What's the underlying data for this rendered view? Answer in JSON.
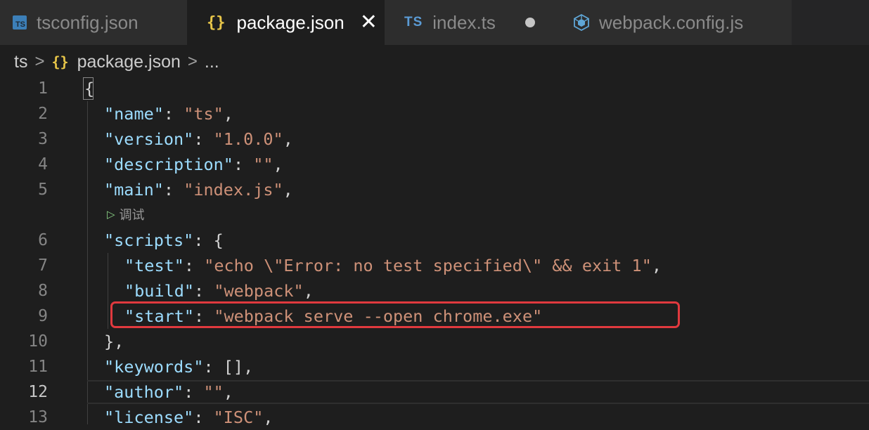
{
  "tabs": [
    {
      "label": "tsconfig.json",
      "icon": "ts-file-icon",
      "active": false
    },
    {
      "label": "package.json",
      "icon": "json-braces-icon",
      "active": true
    },
    {
      "label": "index.ts",
      "icon": "ts-text-icon",
      "active": false,
      "dirty": true
    },
    {
      "label": "webpack.config.js",
      "icon": "webpack-cube-icon",
      "active": false
    }
  ],
  "icon_text": {
    "ts": "TS",
    "braces": "{}",
    "close": "✕"
  },
  "breadcrumb": {
    "root": "ts",
    "file": "package.json",
    "tail": "...",
    "sep": ">"
  },
  "codelens": {
    "label": "调试",
    "icon": "play-icon"
  },
  "current_line": 12,
  "colors": {
    "key": "#9cdcfe",
    "string": "#ce9178",
    "highlight": "#e0393e",
    "accent_braces": "#e8c649"
  },
  "lines": [
    {
      "n": "1",
      "indent": 0,
      "tokens": [
        {
          "t": "{",
          "c": "p"
        }
      ]
    },
    {
      "n": "2",
      "indent": 1,
      "tokens": [
        {
          "t": "\"name\"",
          "c": "k"
        },
        {
          "t": ": ",
          "c": "p"
        },
        {
          "t": "\"ts\"",
          "c": "s"
        },
        {
          "t": ",",
          "c": "p"
        }
      ]
    },
    {
      "n": "3",
      "indent": 1,
      "tokens": [
        {
          "t": "\"version\"",
          "c": "k"
        },
        {
          "t": ": ",
          "c": "p"
        },
        {
          "t": "\"1.0.0\"",
          "c": "s"
        },
        {
          "t": ",",
          "c": "p"
        }
      ]
    },
    {
      "n": "4",
      "indent": 1,
      "tokens": [
        {
          "t": "\"description\"",
          "c": "k"
        },
        {
          "t": ": ",
          "c": "p"
        },
        {
          "t": "\"\"",
          "c": "s"
        },
        {
          "t": ",",
          "c": "p"
        }
      ]
    },
    {
      "n": "5",
      "indent": 1,
      "tokens": [
        {
          "t": "\"main\"",
          "c": "k"
        },
        {
          "t": ": ",
          "c": "p"
        },
        {
          "t": "\"index.js\"",
          "c": "s"
        },
        {
          "t": ",",
          "c": "p"
        }
      ]
    },
    {
      "n": "6",
      "indent": 1,
      "tokens": [
        {
          "t": "\"scripts\"",
          "c": "k"
        },
        {
          "t": ": {",
          "c": "p"
        }
      ]
    },
    {
      "n": "7",
      "indent": 2,
      "tokens": [
        {
          "t": "\"test\"",
          "c": "k"
        },
        {
          "t": ": ",
          "c": "p"
        },
        {
          "t": "\"echo \\\"Error: no test specified\\\" && exit 1\"",
          "c": "s"
        },
        {
          "t": ",",
          "c": "p"
        }
      ]
    },
    {
      "n": "8",
      "indent": 2,
      "tokens": [
        {
          "t": "\"build\"",
          "c": "k"
        },
        {
          "t": ": ",
          "c": "p"
        },
        {
          "t": "\"webpack\"",
          "c": "s"
        },
        {
          "t": ",",
          "c": "p"
        }
      ]
    },
    {
      "n": "9",
      "indent": 2,
      "tokens": [
        {
          "t": "\"start\"",
          "c": "k"
        },
        {
          "t": ": ",
          "c": "p"
        },
        {
          "t": "\"webpack serve --open chrome.exe\"",
          "c": "s"
        }
      ]
    },
    {
      "n": "10",
      "indent": 1,
      "tokens": [
        {
          "t": "},",
          "c": "p"
        }
      ]
    },
    {
      "n": "11",
      "indent": 1,
      "tokens": [
        {
          "t": "\"keywords\"",
          "c": "k"
        },
        {
          "t": ": [],",
          "c": "p"
        }
      ]
    },
    {
      "n": "12",
      "indent": 1,
      "tokens": [
        {
          "t": "\"author\"",
          "c": "k"
        },
        {
          "t": ": ",
          "c": "p"
        },
        {
          "t": "\"\"",
          "c": "s"
        },
        {
          "t": ",",
          "c": "p"
        }
      ]
    },
    {
      "n": "13",
      "indent": 1,
      "tokens": [
        {
          "t": "\"license\"",
          "c": "k"
        },
        {
          "t": ": ",
          "c": "p"
        },
        {
          "t": "\"ISC\"",
          "c": "s"
        },
        {
          "t": ",",
          "c": "p"
        }
      ]
    }
  ]
}
